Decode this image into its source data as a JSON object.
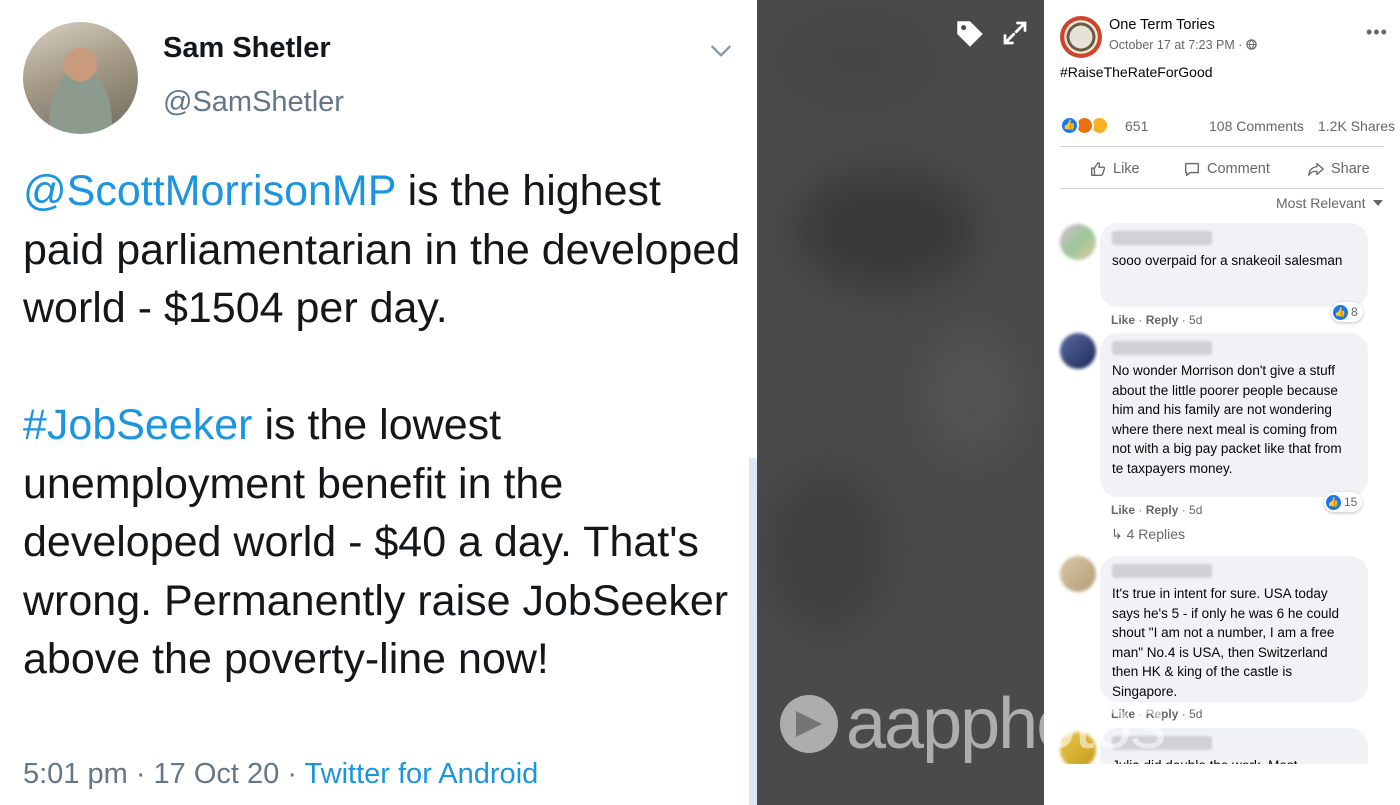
{
  "tweet": {
    "display_name": "Sam Shetler",
    "handle": "@SamShetler",
    "mention": "@ScottMorrisonMP",
    "line1_rest": " is the highest paid parliamentarian in the developed world - $1504 per day.",
    "hashtag": "#JobSeeker",
    "line2_rest": " is the lowest unemployment benefit in the developed world - $40 a day. That's wrong. Permanently raise JobSeeker above the poverty-line now!",
    "time_date": "5:01 pm · 17 Oct 20 · ",
    "source": "Twitter for Android"
  },
  "watermark": {
    "text": "aapphotos"
  },
  "facebook": {
    "page_name": "One Term Tories",
    "post_time": "October 17 at 7:23 PM · ",
    "post_text": "#RaiseTheRateForGood",
    "reaction_count": "651",
    "comments_count": "108 Comments",
    "shares_count": "1.2K Shares",
    "actions": {
      "like": "Like",
      "comment": "Comment",
      "share": "Share"
    },
    "sort_label": "Most Relevant",
    "comments": [
      {
        "text": "sooo overpaid for a snakeoil salesman",
        "like_label": "Like",
        "reply_label": "Reply",
        "age": "5d",
        "likes": "8"
      },
      {
        "text": "No wonder Morrison don't give a stuff about the little poorer people because him and his family are not wondering where there next meal is coming from not with a big pay packet like that from te taxpayers money.",
        "like_label": "Like",
        "reply_label": "Reply",
        "age": "5d",
        "likes": "15",
        "replies": "4 Replies"
      },
      {
        "text": "It's true in intent for sure. USA today says he's 5 - if only he was 6 he could shout \"I am not a number, I am a free man\" No.4 is USA, then Switzerland then HK & king of the castle is Singapore.",
        "like_label": "Like",
        "reply_label": "Reply",
        "age": "5d"
      },
      {
        "text": "Julia did double the work. Most"
      }
    ]
  },
  "colors": {
    "twitter_blue": "#1b95e0",
    "fb_blue": "#1877f2"
  }
}
